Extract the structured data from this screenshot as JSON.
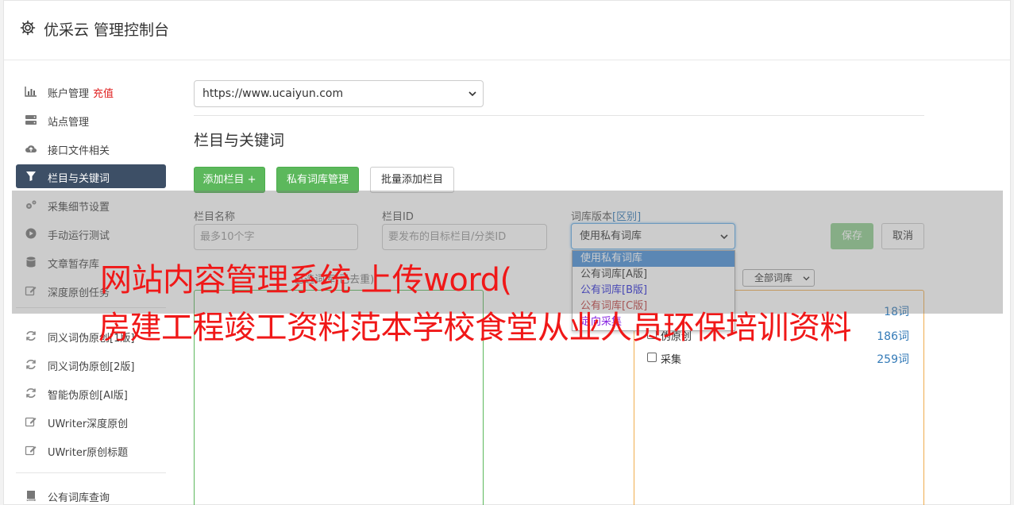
{
  "header": {
    "title": "优采云 管理控制台"
  },
  "sidebar": {
    "items": [
      {
        "label": "账户管理",
        "badge": "充值",
        "icon": "bar-chart-icon"
      },
      {
        "label": "站点管理",
        "icon": "server-icon"
      },
      {
        "label": "接口文件相关",
        "icon": "cloud-upload-icon"
      },
      {
        "label": "栏目与关键词",
        "icon": "filter-icon",
        "active": true
      },
      {
        "label": "采集细节设置",
        "icon": "cogs-icon"
      },
      {
        "label": "手动运行测试",
        "icon": "play-circle-icon"
      },
      {
        "label": "文章暂存库",
        "icon": "database-icon"
      },
      {
        "label": "深度原创任务",
        "icon": "edit-icon"
      },
      {
        "label": "同义词伪原创[1版]",
        "icon": "refresh-icon"
      },
      {
        "label": "同义词伪原创[2版]",
        "icon": "refresh-icon"
      },
      {
        "label": "智能伪原创[AI版]",
        "icon": "refresh-icon"
      },
      {
        "label": "UWriter深度原创",
        "icon": "edit-icon"
      },
      {
        "label": "UWriter原创标题",
        "icon": "edit-icon"
      },
      {
        "label": "公有词库查询",
        "icon": "book-icon"
      }
    ]
  },
  "main": {
    "site_select": {
      "value": "https://www.ucaiyun.com"
    },
    "section_title": "栏目与关键词",
    "buttons": {
      "add_column": "添加栏目 +",
      "private_lib": "私有词库管理",
      "batch_add": "批量添加栏目"
    },
    "form": {
      "column_name_label": "栏目名称",
      "column_name_placeholder": "最多10个字",
      "column_id_label": "栏目ID",
      "column_id_placeholder": "要发布的目标栏目/分类ID",
      "lib_version_label": "词库版本",
      "lib_version_link": "[区别]",
      "lib_version_value": "使用私有词库",
      "save": "保存",
      "cancel": "取消"
    },
    "dropdown_options": [
      "使用私有词库",
      "公有词库[A版]",
      "公有词库[B版]",
      "公有词库[C版]",
      "定向采集"
    ],
    "hint_label": "已选词库(已去重)",
    "lib_filter": "全部词库",
    "lib_rows": [
      {
        "name": "",
        "count": "18词"
      },
      {
        "name": "伪原创",
        "count": "186词"
      },
      {
        "name": "采集",
        "count": "259词"
      }
    ]
  },
  "overlay": {
    "line1": "网站内容管理系统 上传word(",
    "line2": "房建工程竣工资料范本学校食堂从业人员环保培训资料"
  },
  "colors": {
    "accent": "#5cb85c",
    "sidebar_active": "#3d4f66",
    "watermark": "#f01818"
  }
}
